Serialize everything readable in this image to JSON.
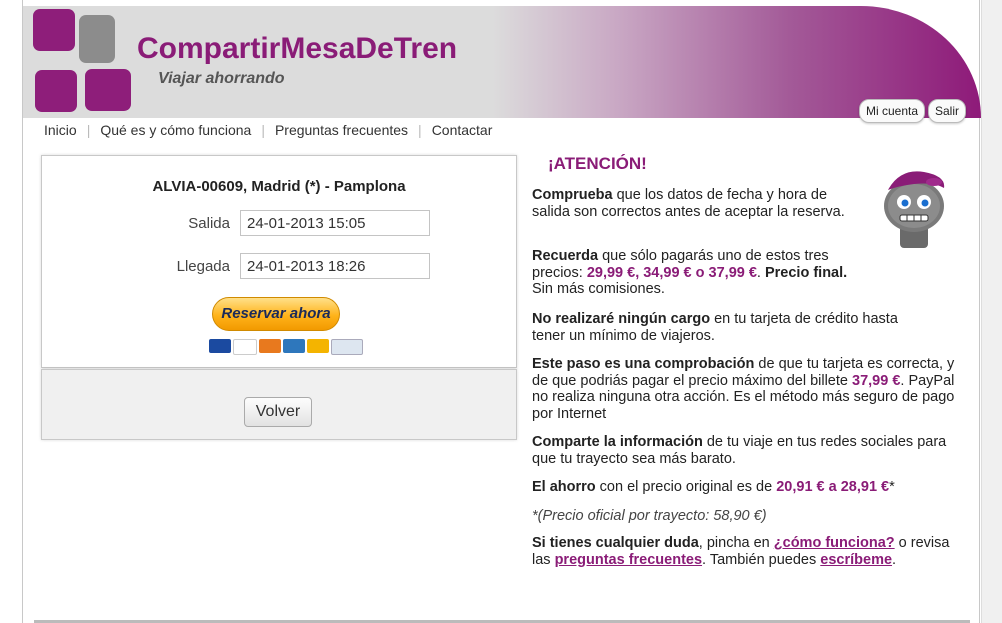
{
  "header": {
    "title": "CompartirMesaDeTren",
    "subtitle": "Viajar ahorrando",
    "my_account": "Mi cuenta",
    "logout": "Salir"
  },
  "nav": [
    "Inicio",
    "Qué es y cómo funciona",
    "Preguntas frecuentes",
    "Contactar"
  ],
  "trip": {
    "route": "ALVIA-00609, Madrid (*) - Pamplona",
    "departure_label": "Salida",
    "departure_value": "24-01-2013 15:05",
    "arrival_label": "Llegada",
    "arrival_value": "24-01-2013 18:26",
    "reserve_button": "Reservar ahora",
    "back_button": "Volver",
    "payment_cards": [
      "Maestro",
      "VISA",
      "MasterCard",
      "Amex",
      "Discover",
      "Cuenta bancaria"
    ]
  },
  "notice": {
    "heading": "¡ATENCIÓN!",
    "p1_bold": "Comprueba",
    "p1_rest": " que los datos de fecha y hora de salida son correctos antes de aceptar la reserva.",
    "p2_bold": "Recuerda",
    "p2_a": " que sólo pagarás uno de estos tres precios: ",
    "p2_prices": "29,99 €, 34,99 € o 37,99 €",
    "p2_b": ". ",
    "p2_final": "Precio final.",
    "p2_c": " Sin más comisiones.",
    "p3_bold": "No realizaré ningún cargo",
    "p3_rest": " en tu tarjeta de crédito hasta tener un mínimo de viajeros.",
    "p4_bold": "Este paso es una comprobación",
    "p4_a": " de que tu tarjeta es correcta, y de que podriás pagar el precio máximo del billete ",
    "p4_price": "37,99 €",
    "p4_b": ". PayPal no realiza ninguna otra acción. Es el método más seguro de pago por Internet",
    "p5_bold": "Comparte la información",
    "p5_rest": " de tu viaje en tus redes sociales para que tu trayecto sea más barato.",
    "p6_bold": "El ahorro",
    "p6_a": " con el precio original es de ",
    "p6_range": "20,91 € a 28,91 €",
    "p6_b": "*",
    "p7": "*(Precio oficial por trayecto: 58,90 €)",
    "p8_bold": "Si tienes cualquier duda",
    "p8_a": ", pincha en ",
    "p8_link1": "¿cómo funciona?",
    "p8_b": " o revisa las ",
    "p8_link2": "preguntas frecuentes",
    "p8_c": ". También puedes ",
    "p8_link3": "escríbeme",
    "p8_d": "."
  },
  "colors": {
    "brand": "#8a1c77",
    "gray": "#8c8c8c"
  }
}
